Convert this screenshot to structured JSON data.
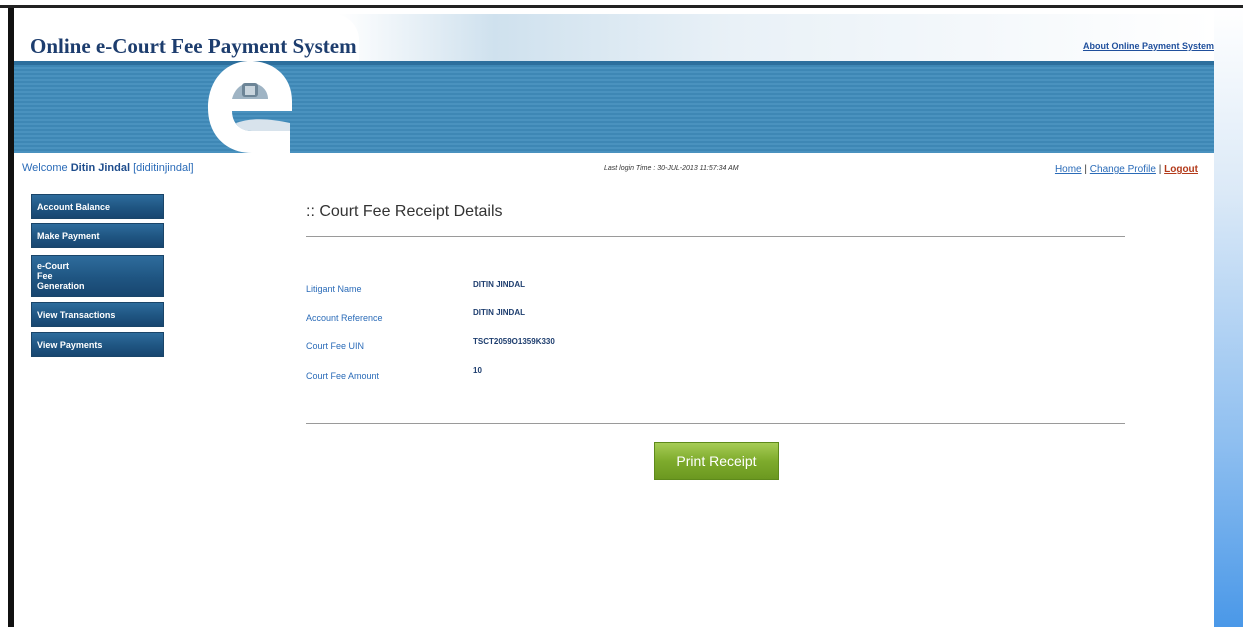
{
  "header": {
    "title": "Online e-Court Fee Payment System",
    "about_link": "About Online Payment System"
  },
  "welcome": {
    "prefix": "Welcome",
    "name": "Ditin Jindal",
    "username": "[diditinjindal]",
    "last_login": "Last login Time : 30-JUL-2013 11:57:34 AM"
  },
  "top_links": {
    "home": "Home",
    "sep1": "|",
    "change_profile": "Change Profile",
    "sep2": "|",
    "logout": "Logout"
  },
  "sidebar": {
    "items": [
      {
        "label": "Account Balance"
      },
      {
        "label": "Make Payment"
      },
      {
        "label": "e-Court Fee Generation"
      },
      {
        "label": "View Transactions"
      },
      {
        "label": "View Payments"
      }
    ]
  },
  "content": {
    "title": ":: Court Fee Receipt Details",
    "fields": [
      {
        "label": "Litigant Name",
        "value": "DITIN JINDAL"
      },
      {
        "label": "Account Reference",
        "value": "DITIN JINDAL"
      },
      {
        "label": "Court Fee UIN",
        "value": "TSCT2059O1359K330"
      },
      {
        "label": "Court Fee Amount",
        "value": "10"
      }
    ],
    "print_button": "Print Receipt"
  },
  "colors": {
    "brand_navy": "#1d3d6e",
    "nav_blue": "#1f5582",
    "link_blue": "#2a6bb8",
    "button_green": "#7eab2c",
    "logout_red": "#b33a1a"
  }
}
